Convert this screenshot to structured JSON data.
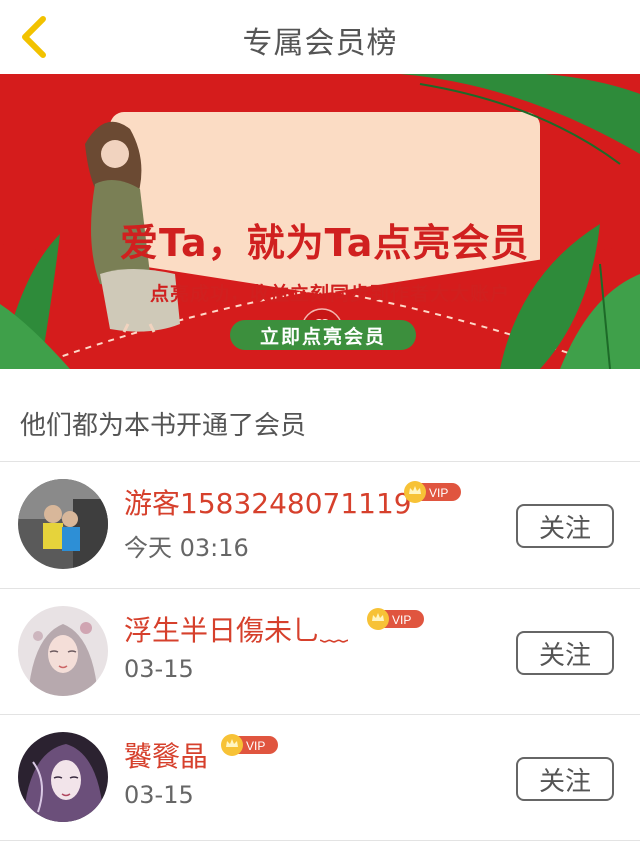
{
  "header": {
    "title": "专属会员榜"
  },
  "banner": {
    "headline": "爱Ta，就为Ta点亮会员",
    "subtitle": "点亮成功，收益立刻同步到作者大大账户",
    "cta_label": "立即点亮会员"
  },
  "section": {
    "label": "他们都为本书开通了会员"
  },
  "members": [
    {
      "name": "游客1583248071119",
      "vip": "VIP",
      "time": "今天 03:16",
      "follow_label": "关注"
    },
    {
      "name": "浮生半日傷未乚﹏",
      "vip": "VIP",
      "time": "03-15",
      "follow_label": "关注"
    },
    {
      "name": "饕餮晶",
      "vip": "VIP",
      "time": "03-15",
      "follow_label": "关注"
    }
  ],
  "colors": {
    "accent": "#d6402c",
    "banner_red": "#d51c1c",
    "cta_green": "#3c8f3d",
    "back_arrow": "#f2c200"
  }
}
